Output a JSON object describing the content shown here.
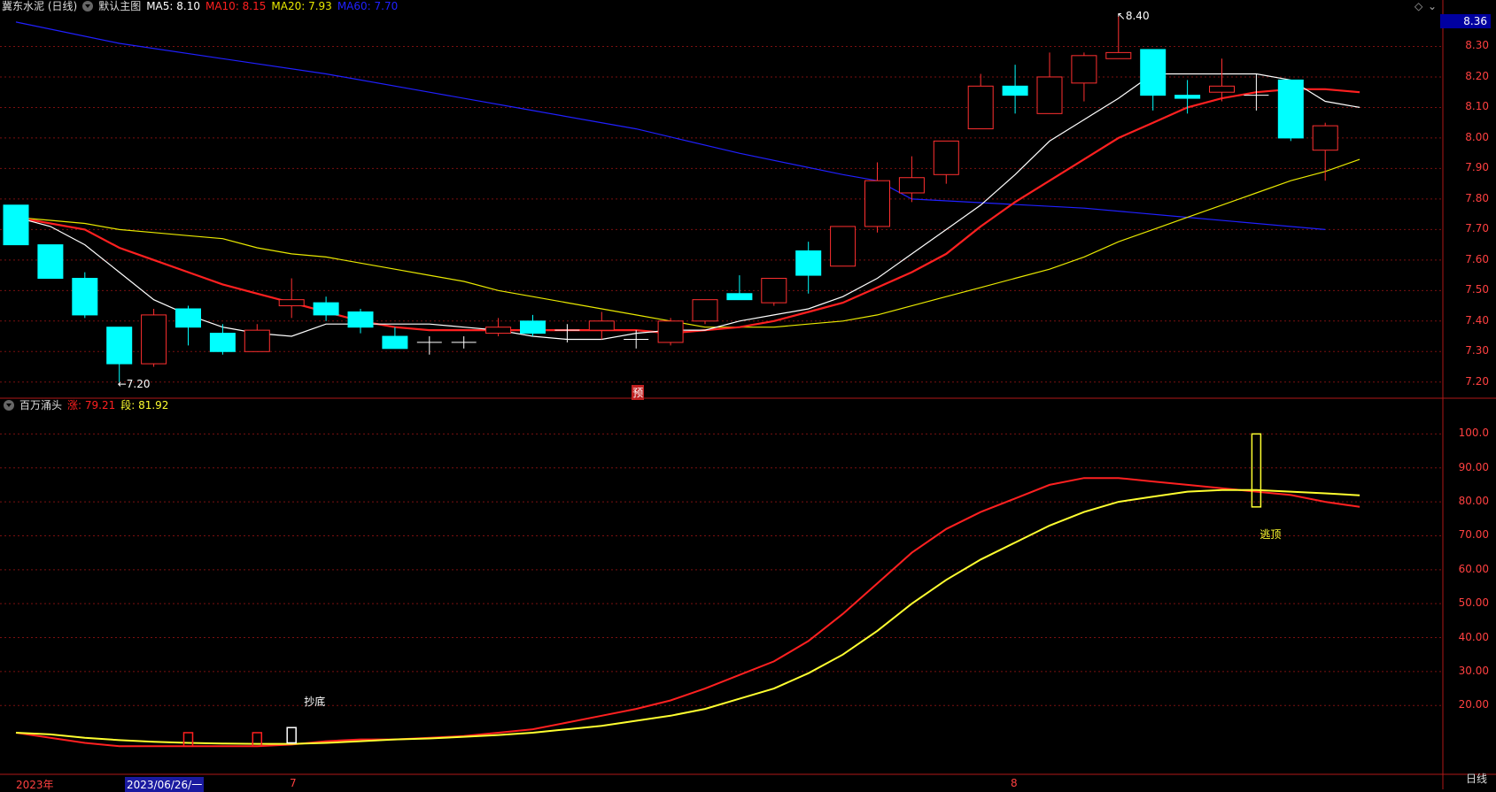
{
  "header": {
    "stock_name": "冀东水泥 (日线)",
    "main_chart_label": "默认主图",
    "ma5": "MA5: 8.10",
    "ma10": "MA10: 8.15",
    "ma20": "MA20: 7.93",
    "ma60": "MA60: 7.70"
  },
  "indicator_header": {
    "name": "百万涌头",
    "line1": "涨: 79.21",
    "line2": "段: 81.92"
  },
  "current_price_box": "8.36",
  "annotations": {
    "high": "8.40",
    "low": "7.20",
    "preview": "预",
    "bottom_signal": "抄底",
    "top_signal": "逃顶"
  },
  "x_labels": {
    "year": "2023年",
    "cursor_date": "2023/06/26/一",
    "month7": "7",
    "month8": "8"
  },
  "period": "日线",
  "colors": {
    "up": "#ff3030",
    "down": "#00ffff",
    "ma5": "#ffffff",
    "ma10": "#ff2020",
    "ma20": "#e8e800",
    "ma60": "#2020ff",
    "ind_line1": "#ff2020",
    "ind_line2": "#ffff30"
  },
  "chart_data": [
    {
      "type": "candlestick",
      "ylim": [
        7.15,
        8.4
      ],
      "y_ticks": [
        "7.20",
        "7.30",
        "7.40",
        "7.50",
        "7.60",
        "7.70",
        "7.80",
        "7.90",
        "8.00",
        "8.10",
        "8.20",
        "8.30"
      ],
      "candles": [
        {
          "o": 7.78,
          "c": 7.65,
          "h": 7.78,
          "l": 7.65
        },
        {
          "o": 7.65,
          "c": 7.54,
          "h": 7.65,
          "l": 7.54
        },
        {
          "o": 7.54,
          "c": 7.42,
          "h": 7.56,
          "l": 7.41
        },
        {
          "o": 7.38,
          "c": 7.26,
          "h": 7.38,
          "l": 7.2
        },
        {
          "o": 7.26,
          "c": 7.42,
          "h": 7.44,
          "l": 7.25
        },
        {
          "o": 7.44,
          "c": 7.38,
          "h": 7.45,
          "l": 7.32
        },
        {
          "o": 7.36,
          "c": 7.3,
          "h": 7.39,
          "l": 7.29
        },
        {
          "o": 7.3,
          "c": 7.37,
          "h": 7.39,
          "l": 7.3
        },
        {
          "o": 7.45,
          "c": 7.47,
          "h": 7.54,
          "l": 7.41
        },
        {
          "o": 7.46,
          "c": 7.42,
          "h": 7.48,
          "l": 7.4
        },
        {
          "o": 7.43,
          "c": 7.38,
          "h": 7.44,
          "l": 7.36
        },
        {
          "o": 7.35,
          "c": 7.31,
          "h": 7.38,
          "l": 7.31
        },
        {
          "o": 7.33,
          "c": 7.33,
          "h": 7.35,
          "l": 7.29
        },
        {
          "o": 7.33,
          "c": 7.33,
          "h": 7.35,
          "l": 7.31
        },
        {
          "o": 7.36,
          "c": 7.38,
          "h": 7.41,
          "l": 7.35
        },
        {
          "o": 7.4,
          "c": 7.36,
          "h": 7.42,
          "l": 7.35
        },
        {
          "o": 7.37,
          "c": 7.37,
          "h": 7.39,
          "l": 7.33
        },
        {
          "o": 7.37,
          "c": 7.4,
          "h": 7.43,
          "l": 7.34
        },
        {
          "o": 7.34,
          "c": 7.34,
          "h": 7.37,
          "l": 7.31
        },
        {
          "o": 7.33,
          "c": 7.4,
          "h": 7.41,
          "l": 7.32
        },
        {
          "o": 7.4,
          "c": 7.47,
          "h": 7.47,
          "l": 7.39
        },
        {
          "o": 7.49,
          "c": 7.47,
          "h": 7.55,
          "l": 7.47
        },
        {
          "o": 7.46,
          "c": 7.54,
          "h": 7.54,
          "l": 7.45
        },
        {
          "o": 7.63,
          "c": 7.55,
          "h": 7.66,
          "l": 7.49
        },
        {
          "o": 7.58,
          "c": 7.71,
          "h": 7.71,
          "l": 7.58
        },
        {
          "o": 7.71,
          "c": 7.86,
          "h": 7.92,
          "l": 7.69
        },
        {
          "o": 7.82,
          "c": 7.87,
          "h": 7.94,
          "l": 7.79
        },
        {
          "o": 7.88,
          "c": 7.99,
          "h": 7.99,
          "l": 7.85
        },
        {
          "o": 8.03,
          "c": 8.17,
          "h": 8.21,
          "l": 8.03
        },
        {
          "o": 8.17,
          "c": 8.14,
          "h": 8.24,
          "l": 8.08
        },
        {
          "o": 8.08,
          "c": 8.2,
          "h": 8.28,
          "l": 8.08
        },
        {
          "o": 8.18,
          "c": 8.27,
          "h": 8.28,
          "l": 8.12
        },
        {
          "o": 8.26,
          "c": 8.28,
          "h": 8.4,
          "l": 8.26
        },
        {
          "o": 8.29,
          "c": 8.14,
          "h": 8.29,
          "l": 8.09
        },
        {
          "o": 8.14,
          "c": 8.13,
          "h": 8.19,
          "l": 8.08
        },
        {
          "o": 8.15,
          "c": 8.17,
          "h": 8.26,
          "l": 8.12
        },
        {
          "o": 8.14,
          "c": 8.14,
          "h": 8.21,
          "l": 8.09
        },
        {
          "o": 8.19,
          "c": 8.0,
          "h": 8.19,
          "l": 7.99
        },
        {
          "o": 7.96,
          "c": 8.04,
          "h": 8.05,
          "l": 7.86
        }
      ],
      "ma5": [
        7.74,
        7.71,
        7.65,
        7.56,
        7.47,
        7.42,
        7.38,
        7.36,
        7.35,
        7.39,
        7.39,
        7.39,
        7.39,
        7.38,
        7.37,
        7.35,
        7.34,
        7.34,
        7.36,
        7.37,
        7.37,
        7.4,
        7.42,
        7.44,
        7.48,
        7.54,
        7.62,
        7.7,
        7.78,
        7.88,
        7.99,
        8.06,
        8.13,
        8.21,
        8.21,
        8.21,
        8.21,
        8.19,
        8.12,
        8.1
      ],
      "ma10": [
        7.74,
        7.72,
        7.7,
        7.64,
        7.6,
        7.56,
        7.52,
        7.49,
        7.46,
        7.43,
        7.4,
        7.38,
        7.37,
        7.37,
        7.37,
        7.37,
        7.37,
        7.37,
        7.37,
        7.36,
        7.37,
        7.38,
        7.4,
        7.43,
        7.46,
        7.51,
        7.56,
        7.62,
        7.71,
        7.79,
        7.86,
        7.93,
        8.0,
        8.05,
        8.1,
        8.13,
        8.15,
        8.16,
        8.16,
        8.15
      ],
      "ma20": [
        7.74,
        7.73,
        7.72,
        7.7,
        7.69,
        7.68,
        7.67,
        7.64,
        7.62,
        7.61,
        7.59,
        7.57,
        7.55,
        7.53,
        7.5,
        7.48,
        7.46,
        7.44,
        7.42,
        7.4,
        7.38,
        7.38,
        7.38,
        7.39,
        7.4,
        7.42,
        7.45,
        7.48,
        7.51,
        7.54,
        7.57,
        7.61,
        7.66,
        7.7,
        7.74,
        7.78,
        7.82,
        7.86,
        7.89,
        7.93
      ],
      "ma60": [
        [
          0,
          8.38
        ],
        [
          3,
          8.31
        ],
        [
          6,
          8.26
        ],
        [
          9,
          8.21
        ],
        [
          12,
          8.15
        ],
        [
          15,
          8.09
        ],
        [
          18,
          8.03
        ],
        [
          21,
          7.95
        ],
        [
          24,
          7.88
        ],
        [
          25,
          7.86
        ],
        [
          26,
          7.8
        ],
        [
          31,
          7.77
        ],
        [
          34,
          7.74
        ],
        [
          38,
          7.7
        ]
      ]
    },
    {
      "type": "line",
      "ylim": [
        0,
        110
      ],
      "y_ticks": [
        "20.00",
        "30.00",
        "40.00",
        "50.00",
        "60.00",
        "70.00",
        "80.00",
        "90.00",
        "100.0"
      ],
      "series": [
        {
          "name": "涨",
          "values": [
            12,
            10.5,
            9,
            8,
            8,
            8,
            8,
            8,
            8.5,
            9.5,
            10,
            10,
            10.5,
            11,
            12,
            13,
            15,
            17,
            19,
            21.5,
            25,
            29,
            33,
            39,
            47,
            56,
            65,
            72,
            77,
            81,
            85,
            87,
            87,
            86,
            85,
            84,
            83,
            82,
            80,
            78.5
          ]
        },
        {
          "name": "段",
          "values": [
            12,
            11.5,
            10.5,
            9.8,
            9.3,
            9,
            8.8,
            8.7,
            8.7,
            9,
            9.5,
            10,
            10.3,
            10.8,
            11.3,
            12,
            13,
            14,
            15.5,
            17,
            19,
            22,
            25,
            29.5,
            35,
            42,
            50,
            57,
            63,
            68,
            73,
            77,
            80,
            81.5,
            83,
            83.5,
            83.5,
            83,
            82.5,
            81.92
          ]
        }
      ],
      "signals": [
        {
          "index": 5,
          "type": "red_box",
          "from": 8,
          "to": 12
        },
        {
          "index": 7,
          "type": "red_box",
          "from": 8,
          "to": 12
        },
        {
          "index": 8,
          "type": "white_box",
          "from": 9,
          "to": 13.5
        },
        {
          "index": 36,
          "type": "yellow_box",
          "from": 78.5,
          "to": 100
        }
      ]
    }
  ]
}
